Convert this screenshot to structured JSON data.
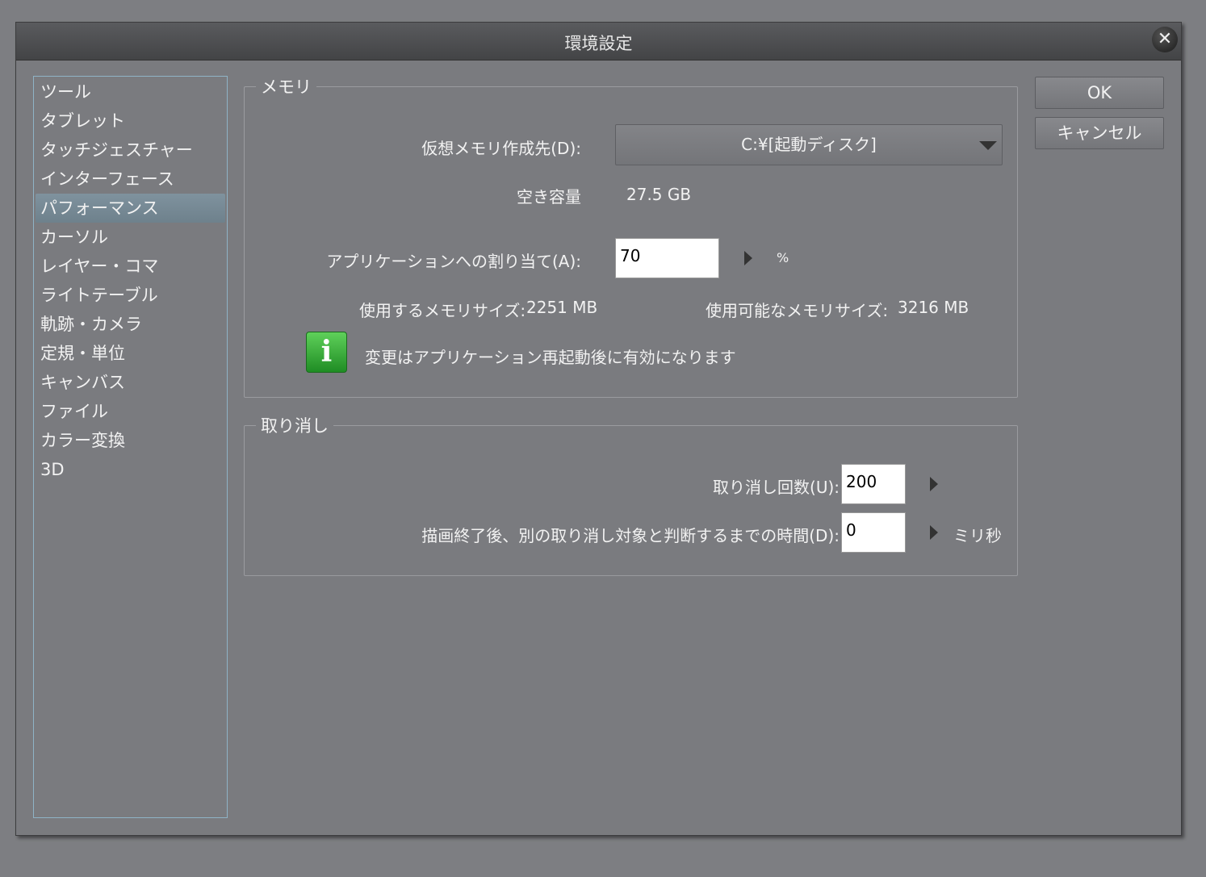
{
  "window": {
    "title": "環境設定",
    "close": "✕"
  },
  "sidebar": {
    "items": [
      "ツール",
      "タブレット",
      "タッチジェスチャー",
      "インターフェース",
      "パフォーマンス",
      "カーソル",
      "レイヤー・コマ",
      "ライトテーブル",
      "軌跡・カメラ",
      "定規・単位",
      "キャンバス",
      "ファイル",
      "カラー変換",
      "3D"
    ],
    "selected": "パフォーマンス"
  },
  "memory": {
    "legend": "メモリ",
    "vm_label": "仮想メモリ作成先(D):",
    "vm_value": "C:¥[起動ディスク]",
    "free_label": "空き容量",
    "free_value": "27.5 GB",
    "alloc_label": "アプリケーションへの割り当て(A):",
    "alloc_value": "70",
    "alloc_unit": "%",
    "used_label": "使用するメモリサイズ:",
    "used_value": "2251 MB",
    "avail_label": "使用可能なメモリサイズ:",
    "avail_value": "3216 MB",
    "info_icon": "i",
    "notice": "変更はアプリケーション再起動後に有効になります"
  },
  "undo": {
    "legend": "取り消し",
    "count_label": "取り消し回数(U):",
    "count_value": "200",
    "time_label": "描画終了後、別の取り消し対象と判断するまでの時間(D):",
    "time_value": "0",
    "time_unit": "ミリ秒"
  },
  "buttons": {
    "ok": "OK",
    "cancel": "キャンセル"
  }
}
